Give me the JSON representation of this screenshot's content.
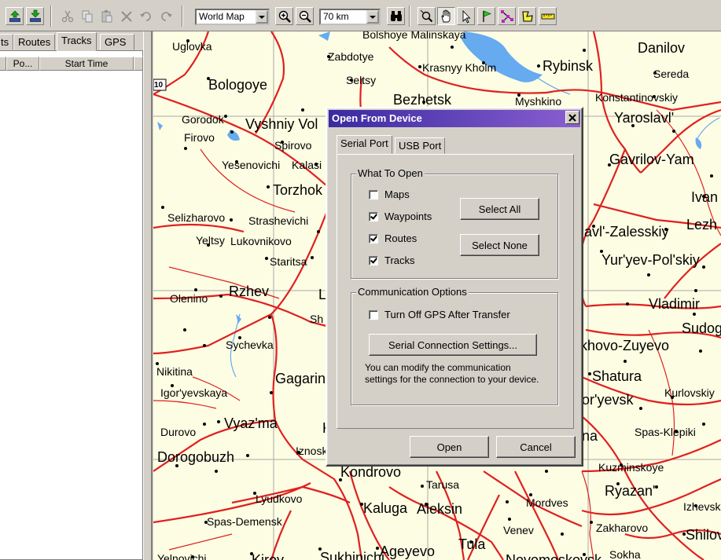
{
  "toolbar": {
    "map_select": "World Map",
    "scale_select": "70 km",
    "buttons": [
      "upload-icon",
      "download-icon",
      "cut-icon",
      "copy-icon",
      "paste-icon",
      "delete-icon",
      "undo-icon",
      "redo-icon",
      "zoom-in-icon",
      "zoom-out-icon",
      "find-icon",
      "zoom-tool-icon",
      "pan-hand-icon",
      "select-arrow-icon",
      "waypoint-flag-icon",
      "route-tool-icon",
      "track-tool-icon",
      "measure-tool-icon"
    ]
  },
  "left_panel": {
    "tabs": [
      "ts",
      "Routes",
      "Tracks",
      "GPS"
    ],
    "active_tab": "Tracks",
    "columns": [
      "Po...",
      "Start Time"
    ]
  },
  "map": {
    "route_marker": "10",
    "cities": [
      {
        "name": "Uglovka",
        "size": "s"
      },
      {
        "name": "Bologoye",
        "size": "l"
      },
      {
        "name": "Zabdotye",
        "size": "s"
      },
      {
        "name": "Seltsy",
        "size": "s"
      },
      {
        "name": "Krasnyy Kholm",
        "size": "s"
      },
      {
        "name": "Rybinsk",
        "size": "l"
      },
      {
        "name": "Danilov",
        "size": "l"
      },
      {
        "name": "Sereda",
        "size": "s"
      },
      {
        "name": "Bezhetsk",
        "size": "l"
      },
      {
        "name": "Myshkino",
        "size": "s"
      },
      {
        "name": "Konstantinovskiy",
        "size": "s"
      },
      {
        "name": "Yaroslavl'",
        "size": "l"
      },
      {
        "name": "Gorodok",
        "size": "s"
      },
      {
        "name": "Vyshniy Vol",
        "size": "l"
      },
      {
        "name": "Firovo",
        "size": "s"
      },
      {
        "name": "Spirovo",
        "size": "s"
      },
      {
        "name": "Yesenovichi",
        "size": "s"
      },
      {
        "name": "Kalasi",
        "size": "s"
      },
      {
        "name": "Gavrilov-Yam",
        "size": "l"
      },
      {
        "name": "Torzhok",
        "size": "l"
      },
      {
        "name": "Ivan",
        "size": "l"
      },
      {
        "name": "Selizharovo",
        "size": "s"
      },
      {
        "name": "Strashevichi",
        "size": "s"
      },
      {
        "name": "Lezh",
        "size": "l"
      },
      {
        "name": "Yeltsy",
        "size": "s"
      },
      {
        "name": "Lukovnikovo",
        "size": "s"
      },
      {
        "name": "lavl'-Zalesskiy",
        "size": "l"
      },
      {
        "name": "Staritsa",
        "size": "s"
      },
      {
        "name": "Yur'yev-Pol'skiy",
        "size": "l"
      },
      {
        "name": "Olenino",
        "size": "s"
      },
      {
        "name": "Rzhev",
        "size": "l"
      },
      {
        "name": "Vladimir",
        "size": "l"
      },
      {
        "name": "Sudog",
        "size": "l"
      },
      {
        "name": "Sychevka",
        "size": "s"
      },
      {
        "name": "khovo-Zuyevo",
        "size": "l"
      },
      {
        "name": "Nikitina",
        "size": "s"
      },
      {
        "name": "Gagarin",
        "size": "l"
      },
      {
        "name": "Shatura",
        "size": "l"
      },
      {
        "name": "Igor'yevskaya",
        "size": "s"
      },
      {
        "name": "Kurlovskiy",
        "size": "s"
      },
      {
        "name": "or'yevsk",
        "size": "l"
      },
      {
        "name": "Durovo",
        "size": "s"
      },
      {
        "name": "Vyaz'ma",
        "size": "l"
      },
      {
        "name": "Spas-Klepiki",
        "size": "s"
      },
      {
        "name": "Dorogobuzh",
        "size": "l"
      },
      {
        "name": "Iznoski",
        "size": "s"
      },
      {
        "name": "Kondrovo",
        "size": "l"
      },
      {
        "name": "Kuzminskoye",
        "size": "s"
      },
      {
        "name": "Tarusa",
        "size": "s"
      },
      {
        "name": "Ryazan'",
        "size": "l"
      },
      {
        "name": "Lyudkovo",
        "size": "s"
      },
      {
        "name": "Kaluga",
        "size": "l"
      },
      {
        "name": "Aleksin",
        "size": "l"
      },
      {
        "name": "Mordves",
        "size": "s"
      },
      {
        "name": "Izhevsk",
        "size": "s"
      },
      {
        "name": "Spas-Demensk",
        "size": "s"
      },
      {
        "name": "Venev",
        "size": "s"
      },
      {
        "name": "Zakharovo",
        "size": "s"
      },
      {
        "name": "Tula",
        "size": "l"
      },
      {
        "name": "Shilov",
        "size": "l"
      },
      {
        "name": "Ageyevo",
        "size": "l"
      },
      {
        "name": "Sukhinichi",
        "size": "l"
      },
      {
        "name": "Kirov",
        "size": "l"
      },
      {
        "name": "Novomoskovsk",
        "size": "l"
      },
      {
        "name": "Sokha",
        "size": "s"
      },
      {
        "name": "Yelnovichi",
        "size": "s"
      },
      {
        "name": "Bolshoye Malinskaya",
        "size": "s"
      },
      {
        "name": "Lo",
        "size": "l"
      },
      {
        "name": "Sh",
        "size": "s"
      },
      {
        "name": "Ku",
        "size": "l"
      },
      {
        "name": "na",
        "size": "l"
      }
    ]
  },
  "dialog": {
    "title": "Open From Device",
    "tabs": [
      "Serial Port",
      "USB Port"
    ],
    "active_tab": "Serial Port",
    "what_to_open": {
      "label": "What To Open",
      "items": [
        {
          "label": "Maps",
          "checked": false
        },
        {
          "label": "Waypoints",
          "checked": true
        },
        {
          "label": "Routes",
          "checked": true
        },
        {
          "label": "Tracks",
          "checked": true
        }
      ],
      "select_all": "Select All",
      "select_none": "Select None"
    },
    "comm": {
      "label": "Communication Options",
      "turn_off": {
        "label": "Turn Off GPS After Transfer",
        "checked": false
      },
      "settings_button": "Serial Connection Settings...",
      "info": "You can modify the communication settings for the connection to your device."
    },
    "open_button": "Open",
    "cancel_button": "Cancel"
  }
}
